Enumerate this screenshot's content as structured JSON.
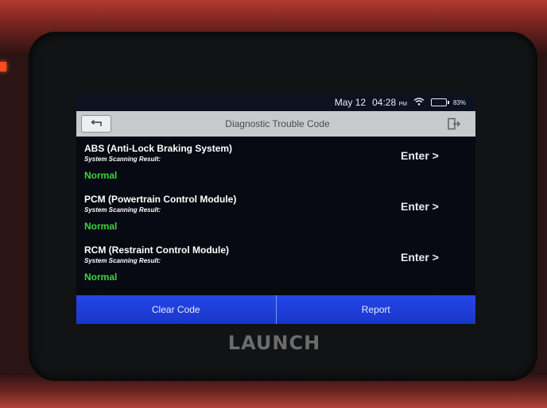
{
  "brand": {
    "logo_text": "LAUNCH"
  },
  "status_bar": {
    "date": "May 12",
    "time": "04:28",
    "ampm": "PM",
    "battery": "83%",
    "wifi_icon": "wifi-icon",
    "battery_icon": "battery-icon"
  },
  "header": {
    "title": "Diagnostic Trouble Code",
    "back_icon": "back-arrow-icon",
    "exit_icon": "exit-icon"
  },
  "modules": [
    {
      "name": "ABS (Anti-Lock Braking System)",
      "scan_label": "System Scanning Result:",
      "result": "Normal",
      "enter_label": "Enter >"
    },
    {
      "name": "PCM (Powertrain Control Module)",
      "scan_label": "System Scanning Result:",
      "result": "Normal",
      "enter_label": "Enter >"
    },
    {
      "name": "RCM (Restraint Control Module)",
      "scan_label": "System Scanning Result:",
      "result": "Normal",
      "enter_label": "Enter >"
    }
  ],
  "actions": {
    "clear_code_label": "Clear Code",
    "report_label": "Report"
  },
  "colors": {
    "accent_blue": "#1d3ad6",
    "normal_green": "#3cd43c",
    "titlebar_gray": "#c7c9cc"
  }
}
